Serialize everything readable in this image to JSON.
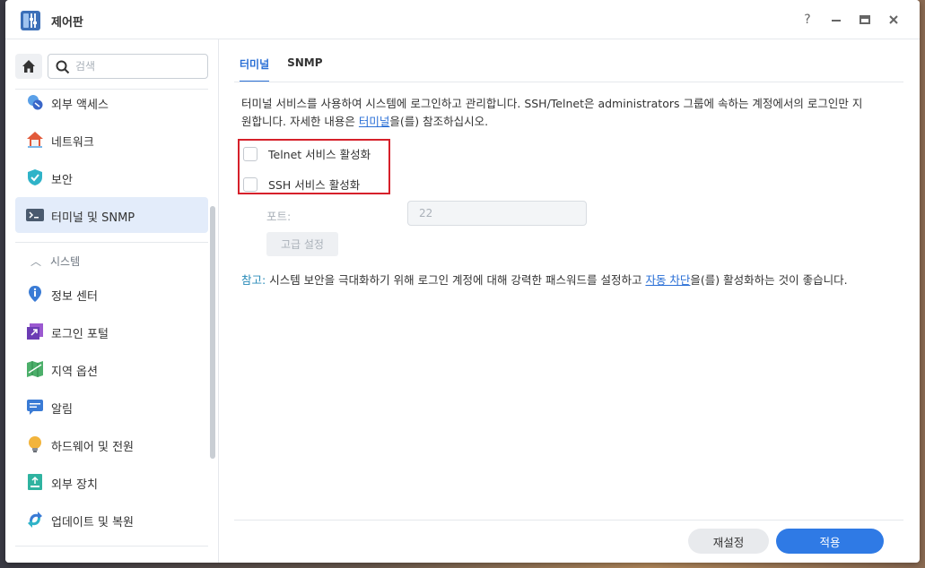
{
  "window": {
    "title": "제어판"
  },
  "titlebar_buttons": {
    "help": "?",
    "minimize": "–",
    "maximize": "▭",
    "close": "✕"
  },
  "sidebar": {
    "search_placeholder": "검색",
    "items": [
      {
        "label": "외부 액세스",
        "icon": "external-access-icon"
      },
      {
        "label": "네트워크",
        "icon": "network-icon"
      },
      {
        "label": "보안",
        "icon": "shield-icon"
      },
      {
        "label": "터미널 및 SNMP",
        "icon": "terminal-icon"
      }
    ],
    "section_label": "시스템",
    "system_items": [
      {
        "label": "정보 센터",
        "icon": "info-icon"
      },
      {
        "label": "로그인 포털",
        "icon": "login-portal-icon"
      },
      {
        "label": "지역 옵션",
        "icon": "regional-options-icon"
      },
      {
        "label": "알림",
        "icon": "notification-icon"
      },
      {
        "label": "하드웨어 및 전원",
        "icon": "bulb-icon"
      },
      {
        "label": "외부 장치",
        "icon": "external-device-icon"
      },
      {
        "label": "업데이트 및 복원",
        "icon": "update-restore-icon"
      }
    ]
  },
  "tabs": [
    {
      "label": "터미널"
    },
    {
      "label": "SNMP"
    }
  ],
  "description": {
    "line1": "터미널 서비스를 사용하여 시스템에 로그인하고 관리합니다. SSH/Telnet은 administrators 그룹에 속하는 계정에서의 로그인만 지",
    "line2_pre": "원합니다. 자세한 내용은 ",
    "line2_link": "터미널",
    "line2_post": "을(를) 참조하십시오."
  },
  "options": {
    "telnet_label": "Telnet 서비스 활성화",
    "ssh_label": "SSH 서비스 활성화",
    "telnet_checked": false,
    "ssh_checked": false
  },
  "port": {
    "label": "포트:",
    "value": "22"
  },
  "advanced_button": "고급 설정",
  "note": {
    "label": "참고:",
    "text_pre": " 시스템 보안을 극대화하기 위해 로그인 계정에 대해 강력한 패스워드를 설정하고 ",
    "link": "자동 차단",
    "text_post": "을(를) 활성화하는 것이 좋습니다."
  },
  "footer": {
    "reset_label": "재설정",
    "apply_label": "적용"
  },
  "colors": {
    "accent": "#2f7ae5",
    "highlight": "#d6202a",
    "active_bg": "#e3ecfa"
  }
}
